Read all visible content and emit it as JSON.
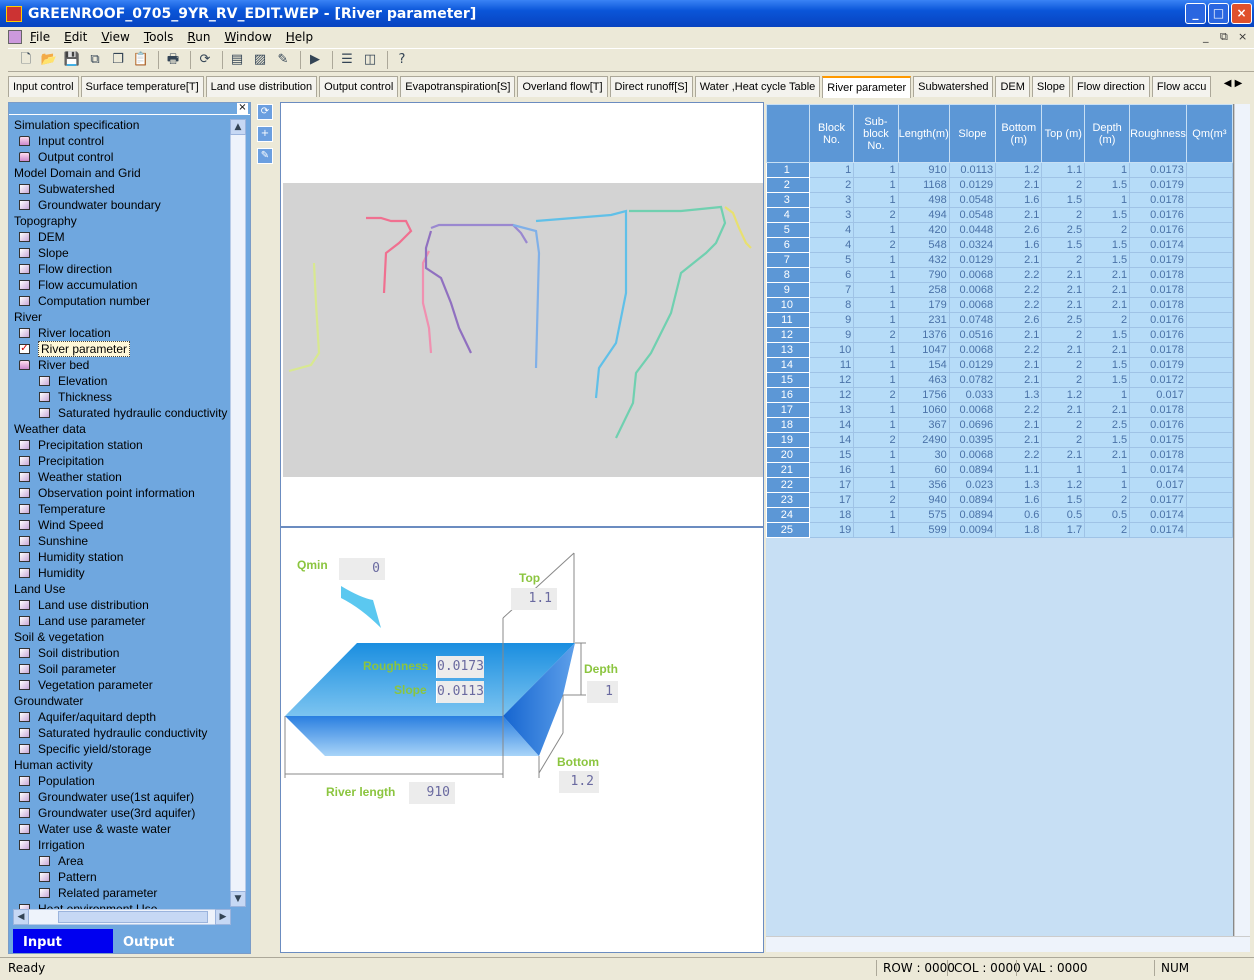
{
  "window": {
    "title": "GREENROOF_0705_9YR_RV_EDIT.WEP - [River parameter]",
    "controls": [
      "_",
      "□",
      "×"
    ]
  },
  "menu": [
    "File",
    "Edit",
    "View",
    "Tools",
    "Run",
    "Window",
    "Help"
  ],
  "mdi_controls": [
    "_",
    "⧉",
    "×"
  ],
  "toolbar": [
    {
      "icon": "new-icon",
      "g": "🗋"
    },
    {
      "icon": "open-icon",
      "g": "📂"
    },
    {
      "icon": "save-icon",
      "g": "💾"
    },
    {
      "icon": "save-all-icon",
      "g": "⧉"
    },
    {
      "icon": "copy-icon",
      "g": "❐"
    },
    {
      "icon": "paste-icon",
      "g": "📋"
    },
    {
      "sep": true
    },
    {
      "icon": "print-icon",
      "g": "🖶"
    },
    {
      "sep": true
    },
    {
      "icon": "refresh-icon",
      "g": "⟳"
    },
    {
      "sep": true
    },
    {
      "icon": "document-icon",
      "g": "▤"
    },
    {
      "icon": "chart-icon",
      "g": "▨"
    },
    {
      "icon": "pencil-icon",
      "g": "✎"
    },
    {
      "sep": true
    },
    {
      "icon": "run-icon",
      "g": "▶"
    },
    {
      "sep": true
    },
    {
      "icon": "split-horizontal-icon",
      "g": "☰"
    },
    {
      "icon": "split-vertical-icon",
      "g": "◫"
    },
    {
      "sep": true
    },
    {
      "icon": "help-icon",
      "g": "?"
    }
  ],
  "tabs": [
    "Input control",
    "Surface temperature[T]",
    "Land use distribution",
    "Output control",
    "Evapotranspiration[S]",
    "Overland flow[T]",
    "Direct runoff[S]",
    "Water ,Heat cycle Table",
    "River parameter",
    "Subwatershed",
    "DEM",
    "Slope",
    "Flow direction",
    "Flow accu"
  ],
  "active_tab": "River parameter",
  "sidebar": {
    "items": [
      {
        "label": "Simulation specification",
        "kind": "header",
        "level": 0
      },
      {
        "label": "Input control",
        "kind": "folder",
        "level": 0
      },
      {
        "label": "Output control",
        "kind": "folder",
        "level": 0
      },
      {
        "label": "Model Domain and Grid",
        "kind": "header",
        "level": 0
      },
      {
        "label": "Subwatershed",
        "kind": "box",
        "level": 0
      },
      {
        "label": "Groundwater boundary",
        "kind": "box",
        "level": 0
      },
      {
        "label": "Topography",
        "kind": "header",
        "level": 0
      },
      {
        "label": "DEM",
        "kind": "box",
        "level": 0
      },
      {
        "label": "Slope",
        "kind": "box",
        "level": 0
      },
      {
        "label": "Flow direction",
        "kind": "box",
        "level": 0
      },
      {
        "label": "Flow accumulation",
        "kind": "box",
        "level": 0
      },
      {
        "label": "Computation number",
        "kind": "box",
        "level": 0
      },
      {
        "label": "River",
        "kind": "header",
        "level": 0
      },
      {
        "label": "River location",
        "kind": "box",
        "level": 0
      },
      {
        "label": "River parameter",
        "kind": "checked",
        "level": 0,
        "selected": true
      },
      {
        "label": "River bed",
        "kind": "folder",
        "level": 0
      },
      {
        "label": "Elevation",
        "kind": "box",
        "level": 1
      },
      {
        "label": "Thickness",
        "kind": "box",
        "level": 1
      },
      {
        "label": "Saturated hydraulic conductivity",
        "kind": "box",
        "level": 1
      },
      {
        "label": "Weather data",
        "kind": "header",
        "level": 0
      },
      {
        "label": "Precipitation station",
        "kind": "box",
        "level": 0
      },
      {
        "label": "Precipitation",
        "kind": "box",
        "level": 0
      },
      {
        "label": "Weather station",
        "kind": "box",
        "level": 0
      },
      {
        "label": "Observation point information",
        "kind": "box",
        "level": 0
      },
      {
        "label": "Temperature",
        "kind": "box",
        "level": 0
      },
      {
        "label": "Wind Speed",
        "kind": "box",
        "level": 0
      },
      {
        "label": "Sunshine",
        "kind": "box",
        "level": 0
      },
      {
        "label": "Humidity station",
        "kind": "box",
        "level": 0
      },
      {
        "label": "Humidity",
        "kind": "box",
        "level": 0
      },
      {
        "label": "Land Use",
        "kind": "header",
        "level": 0
      },
      {
        "label": "Land use distribution",
        "kind": "box",
        "level": 0
      },
      {
        "label": "Land use parameter",
        "kind": "box",
        "level": 0
      },
      {
        "label": "Soil & vegetation",
        "kind": "header",
        "level": 0
      },
      {
        "label": "Soil distribution",
        "kind": "box",
        "level": 0
      },
      {
        "label": "Soil parameter",
        "kind": "box",
        "level": 0
      },
      {
        "label": "Vegetation parameter",
        "kind": "box",
        "level": 0
      },
      {
        "label": "Groundwater",
        "kind": "header",
        "level": 0
      },
      {
        "label": "Aquifer/aquitard depth",
        "kind": "box",
        "level": 0
      },
      {
        "label": "Saturated hydraulic conductivity",
        "kind": "box",
        "level": 0
      },
      {
        "label": "Specific yield/storage",
        "kind": "box",
        "level": 0
      },
      {
        "label": "Human activity",
        "kind": "header",
        "level": 0
      },
      {
        "label": "Population",
        "kind": "box",
        "level": 0
      },
      {
        "label": "Groundwater use(1st aquifer)",
        "kind": "box",
        "level": 0
      },
      {
        "label": "Groundwater use(3rd aquifer)",
        "kind": "box",
        "level": 0
      },
      {
        "label": "Water use & waste water",
        "kind": "box",
        "level": 0
      },
      {
        "label": "Irrigation",
        "kind": "box",
        "level": 0
      },
      {
        "label": "Area",
        "kind": "box",
        "level": 1
      },
      {
        "label": "Pattern",
        "kind": "box",
        "level": 1
      },
      {
        "label": "Related parameter",
        "kind": "box",
        "level": 1
      },
      {
        "label": "Heat environment Use",
        "kind": "box",
        "level": 0
      }
    ],
    "bottom_tabs": {
      "input": "Input",
      "output": "Output"
    }
  },
  "diagram": {
    "qmin_label": "Qmin",
    "qmin": "0",
    "top_label": "Top",
    "top": "1.1",
    "roughness_label": "Roughness",
    "roughness": "0.0173",
    "slope_label": "Slope",
    "slope": "0.0113",
    "depth_label": "Depth",
    "depth": "1",
    "bottom_label": "Bottom",
    "bottom": "1.2",
    "length_label": "River length",
    "length": "910"
  },
  "grid": {
    "columns": [
      "Block No.",
      "Sub-block No.",
      "Length(m)",
      "Slope",
      "Bottom (m)",
      "Top (m)",
      "Depth (m)",
      "Roughness",
      "Qm(m³"
    ],
    "rows": [
      [
        "1",
        "1",
        "1",
        "910",
        "0.0113",
        "1.2",
        "1.1",
        "1",
        "0.0173"
      ],
      [
        "2",
        "2",
        "1",
        "1168",
        "0.0129",
        "2.1",
        "2",
        "1.5",
        "0.0179"
      ],
      [
        "3",
        "3",
        "1",
        "498",
        "0.0548",
        "1.6",
        "1.5",
        "1",
        "0.0178"
      ],
      [
        "4",
        "3",
        "2",
        "494",
        "0.0548",
        "2.1",
        "2",
        "1.5",
        "0.0176"
      ],
      [
        "5",
        "4",
        "1",
        "420",
        "0.0448",
        "2.6",
        "2.5",
        "2",
        "0.0176"
      ],
      [
        "6",
        "4",
        "2",
        "548",
        "0.0324",
        "1.6",
        "1.5",
        "1.5",
        "0.0174"
      ],
      [
        "7",
        "5",
        "1",
        "432",
        "0.0129",
        "2.1",
        "2",
        "1.5",
        "0.0179"
      ],
      [
        "8",
        "6",
        "1",
        "790",
        "0.0068",
        "2.2",
        "2.1",
        "2.1",
        "0.0178"
      ],
      [
        "9",
        "7",
        "1",
        "258",
        "0.0068",
        "2.2",
        "2.1",
        "2.1",
        "0.0178"
      ],
      [
        "10",
        "8",
        "1",
        "179",
        "0.0068",
        "2.2",
        "2.1",
        "2.1",
        "0.0178"
      ],
      [
        "11",
        "9",
        "1",
        "231",
        "0.0748",
        "2.6",
        "2.5",
        "2",
        "0.0176"
      ],
      [
        "12",
        "9",
        "2",
        "1376",
        "0.0516",
        "2.1",
        "2",
        "1.5",
        "0.0176"
      ],
      [
        "13",
        "10",
        "1",
        "1047",
        "0.0068",
        "2.2",
        "2.1",
        "2.1",
        "0.0178"
      ],
      [
        "14",
        "11",
        "1",
        "154",
        "0.0129",
        "2.1",
        "2",
        "1.5",
        "0.0179"
      ],
      [
        "15",
        "12",
        "1",
        "463",
        "0.0782",
        "2.1",
        "2",
        "1.5",
        "0.0172"
      ],
      [
        "16",
        "12",
        "2",
        "1756",
        "0.033",
        "1.3",
        "1.2",
        "1",
        "0.017"
      ],
      [
        "17",
        "13",
        "1",
        "1060",
        "0.0068",
        "2.2",
        "2.1",
        "2.1",
        "0.0178"
      ],
      [
        "18",
        "14",
        "1",
        "367",
        "0.0696",
        "2.1",
        "2",
        "2.5",
        "0.0176"
      ],
      [
        "19",
        "14",
        "2",
        "2490",
        "0.0395",
        "2.1",
        "2",
        "1.5",
        "0.0175"
      ],
      [
        "20",
        "15",
        "1",
        "30",
        "0.0068",
        "2.2",
        "2.1",
        "2.1",
        "0.0178"
      ],
      [
        "21",
        "16",
        "1",
        "60",
        "0.0894",
        "1.1",
        "1",
        "1",
        "0.0174"
      ],
      [
        "22",
        "17",
        "1",
        "356",
        "0.023",
        "1.3",
        "1.2",
        "1",
        "0.017"
      ],
      [
        "23",
        "17",
        "2",
        "940",
        "0.0894",
        "1.6",
        "1.5",
        "2",
        "0.0177"
      ],
      [
        "24",
        "18",
        "1",
        "575",
        "0.0894",
        "0.6",
        "0.5",
        "0.5",
        "0.0174"
      ],
      [
        "25",
        "19",
        "1",
        "599",
        "0.0094",
        "1.8",
        "1.7",
        "2",
        "0.0174"
      ]
    ]
  },
  "status": {
    "text": "Ready",
    "row": "ROW : 0000",
    "col": "COL : 0000",
    "val": "VAL : 0000",
    "num": "NUM"
  },
  "colors": {
    "title_blue": "#0a55d8",
    "panel_blue": "#6fa7df",
    "grid_header": "#5c97d6",
    "grid_cell": "#b6dcf8",
    "label_green": "#8bc53f",
    "input_tab": "#0000f0"
  }
}
